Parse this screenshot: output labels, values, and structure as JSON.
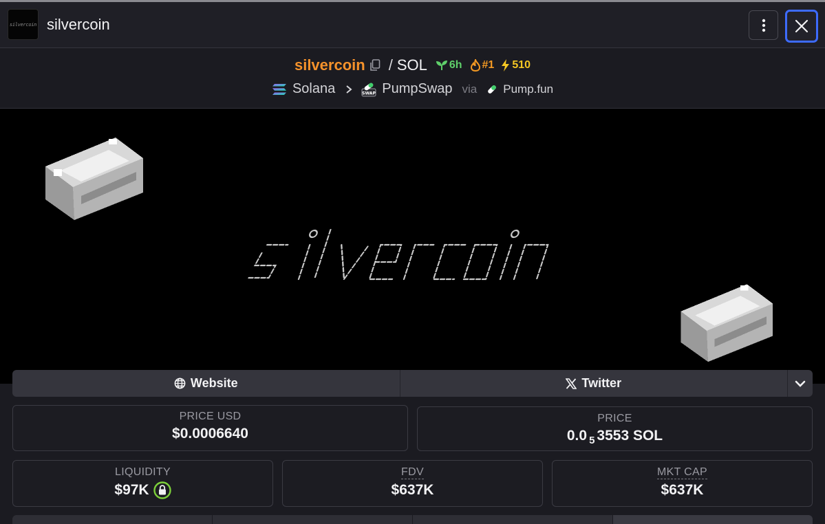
{
  "header": {
    "logo_text": "silvercoin",
    "title": "silvercoin"
  },
  "pair": {
    "token_name": "silvercoin",
    "separator": "/",
    "quote": "SOL",
    "age": "6h",
    "rank": "#1",
    "boosts": "510",
    "chain": "Solana",
    "dex": "PumpSwap",
    "via_label": "via",
    "launchpad": "Pump.fun"
  },
  "banner": {
    "ascii_art": [
      "        _           _         ",
      "   ___(_) |_   _____ _ __ ___ ___ (_)_ __  ",
      "  / __| | \\ \\ / / _ \\ '__/ __/ _ \\| | '_ \\ ",
      "  \\__ \\ | |\\ V /  __/ | | (_| (_) | | | | |",
      "  |___/_|_| \\_/ \\___|_|  \\___\\___/|_|_| |_|"
    ]
  },
  "links": {
    "website": "Website",
    "twitter": "Twitter"
  },
  "stats": {
    "price_usd_label": "PRICE USD",
    "price_usd_value": "$0.0006640",
    "price_label": "PRICE",
    "price_prefix": "0.0",
    "price_zeros": "5",
    "price_suffix": "3553 SOL",
    "liquidity_label": "LIQUIDITY",
    "liquidity_value": "$97K",
    "fdv_label": "FDV",
    "fdv_value": "$637K",
    "mktcap_label": "MKT CAP",
    "mktcap_value": "$637K"
  },
  "colors": {
    "accent_token": "#f5922b",
    "age_green": "#5fcf6a",
    "rank_orange": "#f59a23",
    "boost_yellow": "#f5c723",
    "focus_blue": "#3d6bff",
    "lock_green": "#7ccf3a"
  },
  "icons": [
    "copy-icon",
    "seedling-icon",
    "flame-icon",
    "bolt-icon",
    "solana-icon",
    "chevron-right-icon",
    "pumpswap-icon",
    "pill-icon",
    "globe-icon",
    "x-logo-icon",
    "chevron-down-icon",
    "lock-icon",
    "kebab-icon",
    "close-icon"
  ]
}
